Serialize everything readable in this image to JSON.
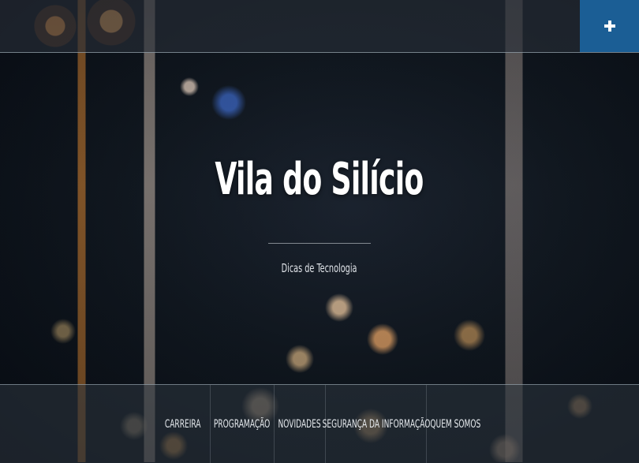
{
  "site": {
    "title": "Vila do Silício",
    "tagline": "Dicas de Tecnologia"
  },
  "header": {
    "menu_toggle_icon": "plus-icon",
    "accent_color": "#1b5e95"
  },
  "nav": {
    "items": [
      {
        "label": "CARREIRA"
      },
      {
        "label": "PROGRAMAÇÃO"
      },
      {
        "label": "NOVIDADES"
      },
      {
        "label": "SEGURANÇA DA INFORMAÇÃO"
      },
      {
        "label": "QUEM SOMOS"
      }
    ]
  }
}
